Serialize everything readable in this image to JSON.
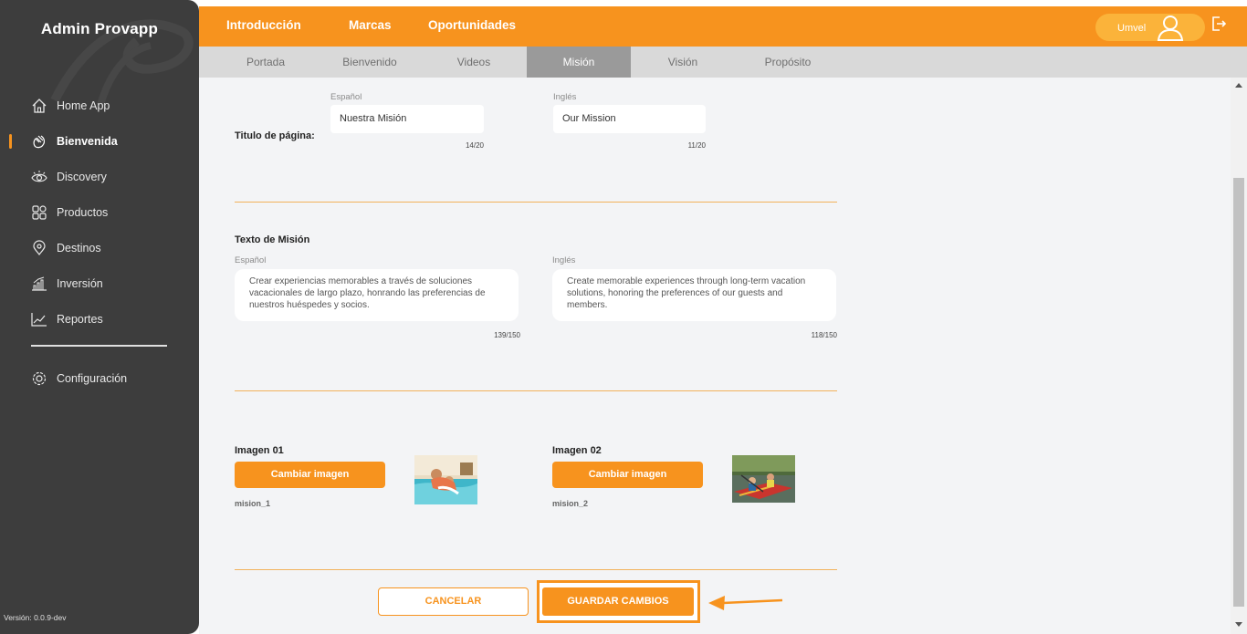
{
  "sidebar": {
    "brand": "Admin Provapp",
    "items": [
      {
        "label": "Home App",
        "icon": "home-icon"
      },
      {
        "label": "Bienvenida",
        "icon": "wave-hand-icon",
        "active": true
      },
      {
        "label": "Discovery",
        "icon": "eye-icon"
      },
      {
        "label": "Productos",
        "icon": "grid-icon"
      },
      {
        "label": "Destinos",
        "icon": "map-pin-icon"
      },
      {
        "label": "Inversión",
        "icon": "bar-chart-icon"
      },
      {
        "label": "Reportes",
        "icon": "line-chart-icon"
      }
    ],
    "config": {
      "label": "Configuración",
      "icon": "gear-icon"
    },
    "version": "Versión: 0.0.9-dev"
  },
  "topbar": {
    "tabs": [
      "Introducción",
      "Marcas",
      "Oportunidades"
    ],
    "active_tab": "Introducción",
    "user_name": "Umvel",
    "accent": "#f7931e"
  },
  "subtabs": {
    "items": [
      "Portada",
      "Bienvenido",
      "Videos",
      "Misión",
      "Visión",
      "Propósito"
    ],
    "active": "Misión"
  },
  "form": {
    "page_title": {
      "label": "Titulo de página:",
      "es_label": "Español",
      "es_value": "Nuestra Misión",
      "es_count": "14/20",
      "en_label": "Inglés",
      "en_value": "Our Mission",
      "en_count": "11/20"
    },
    "mission_text": {
      "label": "Texto de Misión",
      "es_label": "Español",
      "es_value": "Crear experiencias memorables a través de soluciones vacacionales de largo plazo, honrando las preferencias de nuestros huéspedes y socios.",
      "es_count": "139/150",
      "en_label": "Inglés",
      "en_value": "Create memorable experiences through long-term vacation solutions, honoring the preferences of our guests and members.",
      "en_count": "118/150"
    },
    "images": [
      {
        "title": "Imagen 01",
        "button": "Cambiar imagen",
        "caption": "mision_1"
      },
      {
        "title": "Imagen 02",
        "button": "Cambiar imagen",
        "caption": "mision_2"
      }
    ],
    "cancel_label": "CANCELAR",
    "save_label": "GUARDAR CAMBIOS"
  }
}
